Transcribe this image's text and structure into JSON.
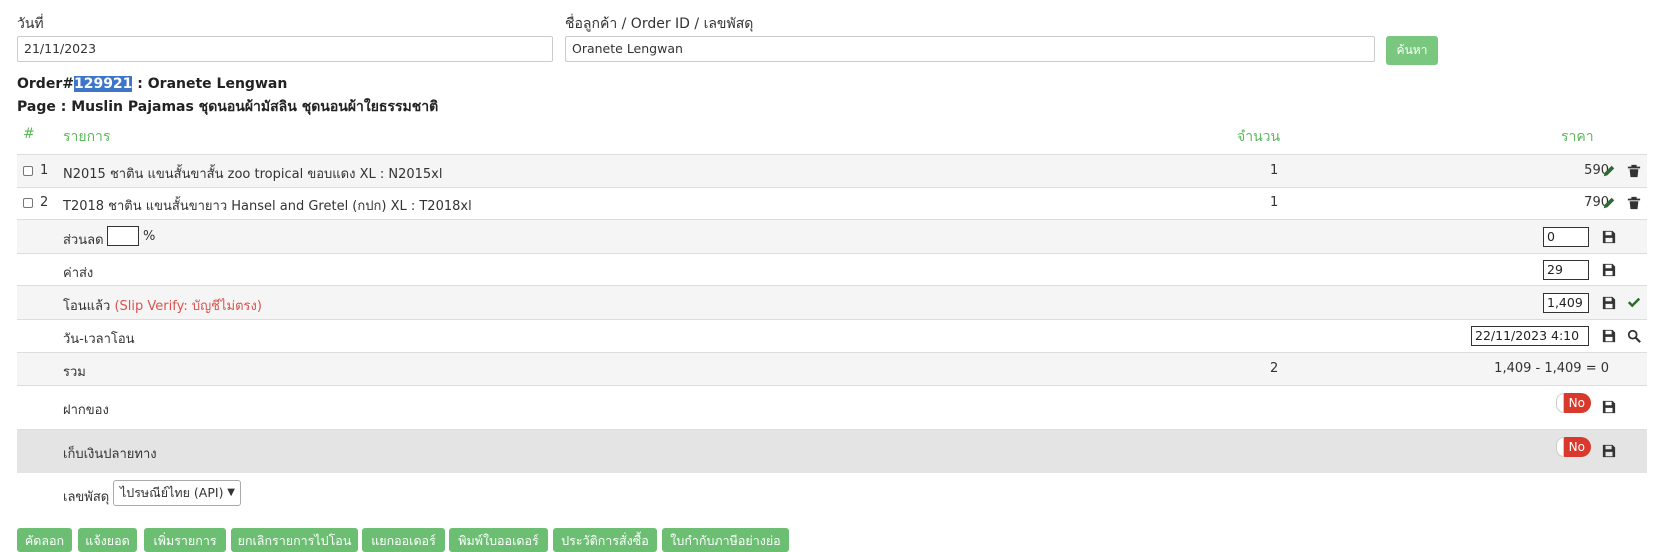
{
  "search": {
    "date_label": "วันที่",
    "date_value": "21/11/2023",
    "customer_label": "ชื่อลูกค้า / Order ID / เลขพัสดุ",
    "customer_value": "Oranete Lengwan",
    "search_button": "ค้นหา"
  },
  "order": {
    "prefix": "Order#",
    "id": "129921",
    "customer": " : Oranete Lengwan",
    "page_line": "Page : Muslin Pajamas ชุดนอนผ้ามัสลิน ชุดนอนผ้าใยธรรมชาติ"
  },
  "table": {
    "headers": {
      "num": "#",
      "item": "รายการ",
      "qty": "จำนวน",
      "price": "ราคา"
    },
    "items": [
      {
        "num": "1",
        "name": "N2015 ชาติน แขนสั้นขาสั้น zoo tropical ขอบแดง XL : N2015xl",
        "qty": "1",
        "price": "590"
      },
      {
        "num": "2",
        "name": "T2018 ชาติน แขนสั้นขายาว Hansel and Gretel (กปก) XL : T2018xl",
        "qty": "1",
        "price": "790"
      }
    ],
    "discount": {
      "label": "ส่วนลด",
      "value": "",
      "unit": "%",
      "amount": "0"
    },
    "shipping": {
      "label": "ค่าส่ง",
      "amount": "29"
    },
    "paid": {
      "label": "โอนแล้ว",
      "note": "(Slip Verify: บัญชีไม่ตรง)",
      "amount": "1,409"
    },
    "transfer_time": {
      "label": "วัน-เวลาโอน",
      "value": "22/11/2023 4:10"
    },
    "total": {
      "label": "รวม",
      "qty": "2",
      "summary": "1,409 - 1,409 = 0"
    },
    "deposit": {
      "label": "ฝากของ",
      "toggle": "No"
    },
    "cod": {
      "label": "เก็บเงินปลายทาง",
      "toggle": "No"
    },
    "tracking": {
      "label": "เลขพัสดุ",
      "carrier": "ไปรษณีย์ไทย (API)"
    }
  },
  "actions": [
    "คัดลอก",
    "แจ้งยอด",
    "เพิ่มรายการ",
    "ยกเลิกรายการไปโอน",
    "แยกออเดอร์",
    "พิมพ์ใบออเดอร์",
    "ประวัติการสั่งซื้อ",
    "ใบกำกับภาษีอย่างย่อ"
  ],
  "colors": {
    "accent": "#5cb85c",
    "button": "#6cbf72",
    "danger": "#d9534f",
    "highlight": "#3c76c9"
  }
}
